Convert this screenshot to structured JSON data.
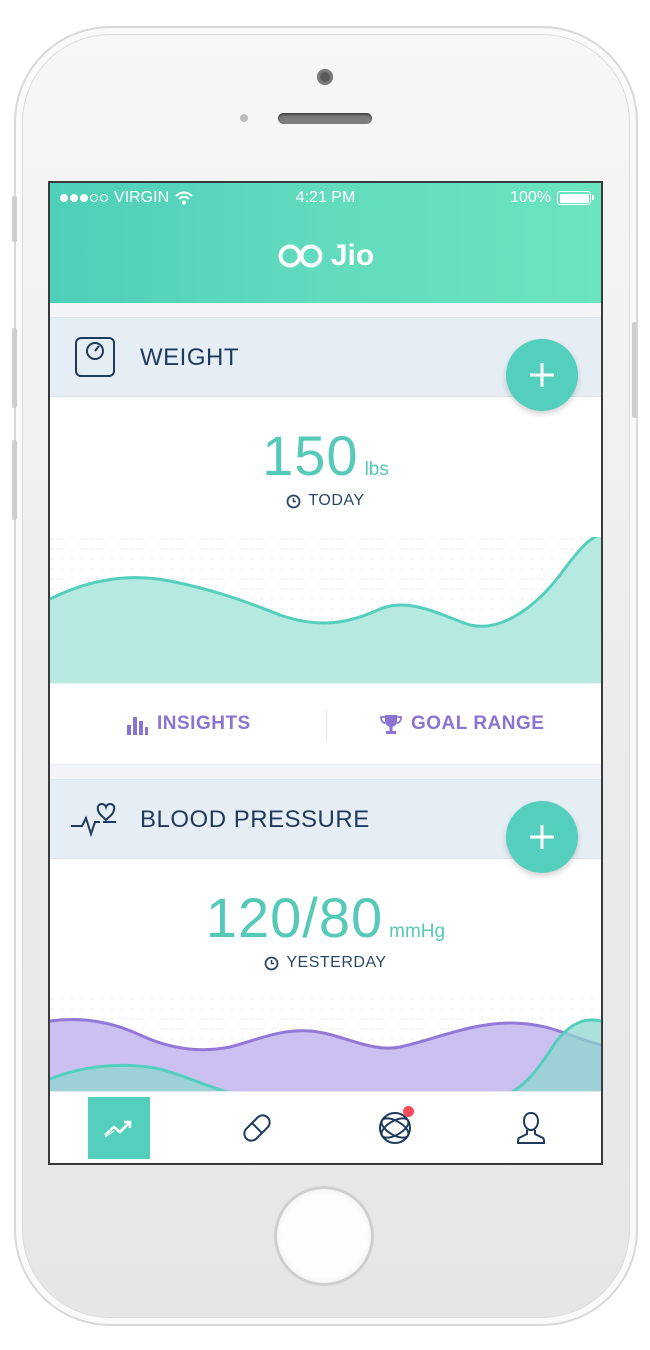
{
  "status_bar": {
    "carrier": "VIRGIN",
    "time": "4:21 PM",
    "battery": "100%"
  },
  "header": {
    "brand": "Jio",
    "logo_icon": "infinity-logo-icon"
  },
  "weight": {
    "title": "WEIGHT",
    "icon": "scale-icon",
    "value": "150",
    "unit": "lbs",
    "when": "TODAY",
    "add_icon": "plus-icon",
    "actions": {
      "insights": "INSIGHTS",
      "goal_range": "GOAL RANGE"
    }
  },
  "blood_pressure": {
    "title": "BLOOD PRESSURE",
    "icon": "heart-pulse-icon",
    "value": "120/80",
    "unit": "mmHg",
    "when": "YESTERDAY",
    "add_icon": "plus-icon"
  },
  "tabs": [
    {
      "name": "trends",
      "icon": "trend-chart-icon",
      "active": true
    },
    {
      "name": "medications",
      "icon": "pill-icon",
      "active": false
    },
    {
      "name": "community",
      "icon": "globe-icon",
      "active": false,
      "badge": true
    },
    {
      "name": "profile",
      "icon": "user-icon",
      "active": false
    }
  ],
  "colors": {
    "accent": "#54cfbd",
    "header_gradient_start": "#4ecfb8",
    "header_gradient_end": "#6be4c0",
    "title_text": "#1f3a5a",
    "action_purple": "#8a73d3",
    "bp_series_fill": "#c7b9ee",
    "badge_red": "#ff4a5a"
  }
}
